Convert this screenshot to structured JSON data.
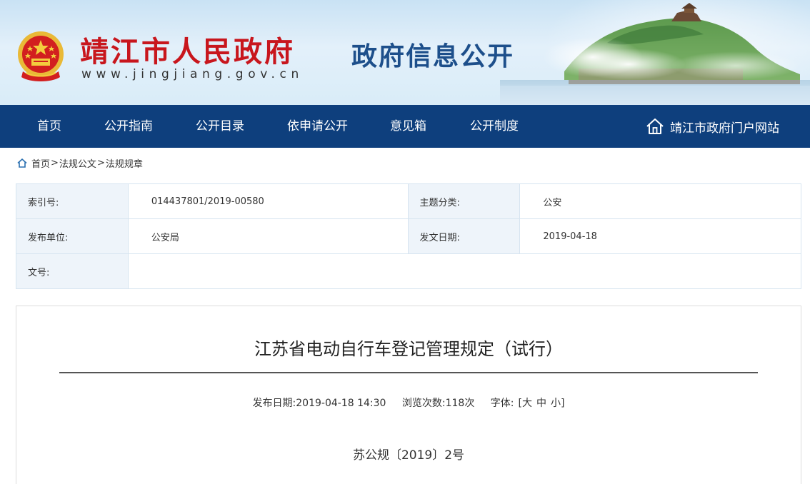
{
  "header": {
    "site_title": "靖江市人民政府",
    "site_url": "www.jingjiang.gov.cn",
    "section_title": "政府信息公开"
  },
  "nav": {
    "items": [
      {
        "label": "首页"
      },
      {
        "label": "公开指南"
      },
      {
        "label": "公开目录"
      },
      {
        "label": "依申请公开"
      },
      {
        "label": "意见箱"
      },
      {
        "label": "公开制度"
      }
    ],
    "portal_label": "靖江市政府门户网站"
  },
  "breadcrumb": {
    "items": [
      "首页",
      "法规公文",
      "法规规章"
    ],
    "separator": ">"
  },
  "meta": {
    "index_no_label": "索引号:",
    "index_no_value": "014437801/2019-00580",
    "topic_label": "主题分类:",
    "topic_value": "公安",
    "publisher_label": "发布单位:",
    "publisher_value": "公安局",
    "issue_date_label": "发文日期:",
    "issue_date_value": "2019-04-18",
    "doc_no_label": "文号:",
    "doc_no_value": ""
  },
  "article": {
    "title": "江苏省电动自行车登记管理规定（试行）",
    "publish_label": "发布日期:",
    "publish_value": "2019-04-18 14:30",
    "views_label": "浏览次数:",
    "views_value": "118次",
    "font_label": "字体:",
    "font_open": "[",
    "font_large": "大",
    "font_medium": "中",
    "font_small": "小",
    "font_close": "]",
    "doc_number": "苏公规〔2019〕2号"
  },
  "colors": {
    "nav_bg": "#0e3f7d",
    "title_red": "#c8161d",
    "section_blue": "#1d4f8b",
    "label_bg": "#eef4fa"
  }
}
